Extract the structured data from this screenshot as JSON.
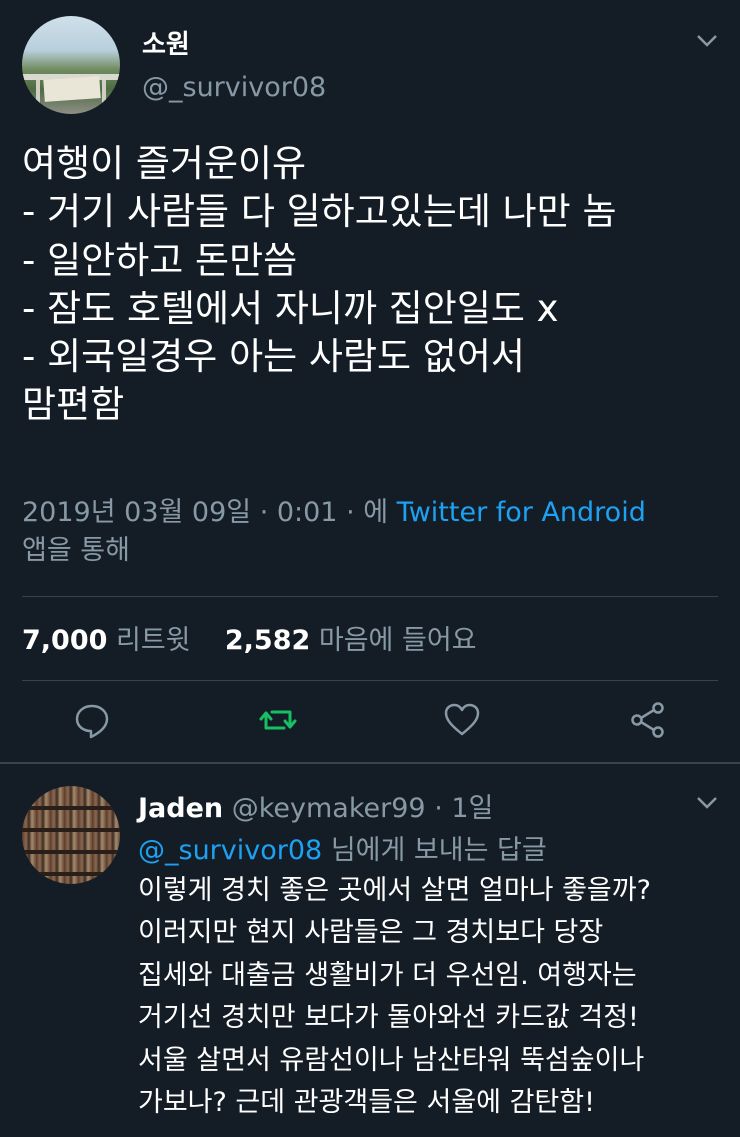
{
  "tweet": {
    "name": "소원",
    "handle": "@_survivor08",
    "body": "여행이 즐거운이유\n- 거기 사람들 다 일하고있는데 나만 놈\n- 일안하고 돈만씀\n- 잠도 호텔에서 자니까 집안일도 x\n- 외국일경우 아는 사람도 없어서\n맘편함",
    "meta_date": "2019년 03월 09일 · 0:01 · 에 ",
    "meta_app": "Twitter for Android",
    "meta_suffix": "앱을 통해",
    "retweet_count": "7,000",
    "retweet_label": "리트윗",
    "like_count": "2,582",
    "like_label": "마음에 들어요"
  },
  "icons": {
    "reply": "reply-icon",
    "retweet": "retweet-icon",
    "like": "heart-icon",
    "share": "share-icon"
  },
  "colors": {
    "background": "#141d26",
    "accent": "#1da1f2",
    "retweet_green": "#17bf63",
    "muted": "#8899a6",
    "divider": "#38444d"
  },
  "reply": {
    "name": "Jaden",
    "handle": "@keymaker99",
    "time": "· 1일",
    "mention": "@_survivor08",
    "reply_to_label": "님에게 보내는 답글",
    "body": "이렇게 경치 좋은 곳에서 살면 얼마나 좋을까?\n이러지만 현지 사람들은 그 경치보다 당장\n집세와 대출금 생활비가 더 우선임.  여행자는\n거기선 경치만 보다가 돌아와선 카드값 걱정!\n서울 살면서 유람선이나 남산타워 뚝섬숲이나\n가보나? 근데 관광객들은 서울에 감탄함!"
  }
}
